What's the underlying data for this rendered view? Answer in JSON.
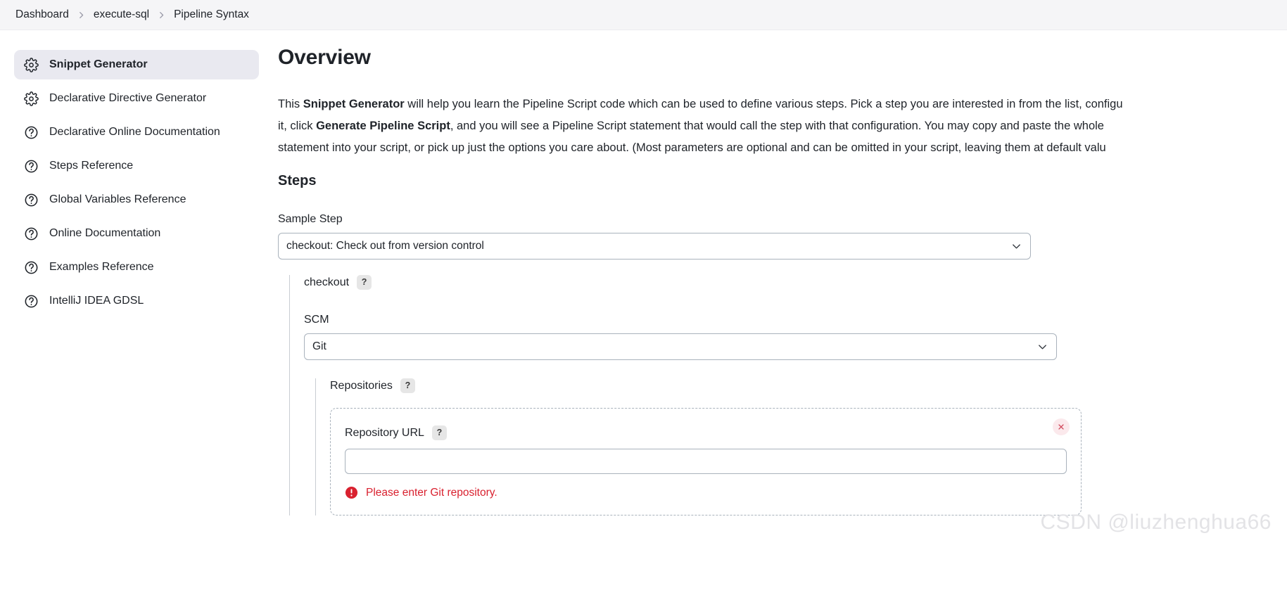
{
  "breadcrumb": {
    "items": [
      {
        "label": "Dashboard"
      },
      {
        "label": "execute-sql"
      },
      {
        "label": "Pipeline Syntax"
      }
    ],
    "separator_icon": "chevron-right-icon"
  },
  "sidebar": {
    "items": [
      {
        "label": "Snippet Generator",
        "icon": "gear-icon",
        "active": true
      },
      {
        "label": "Declarative Directive Generator",
        "icon": "gear-icon",
        "active": false
      },
      {
        "label": "Declarative Online Documentation",
        "icon": "question-circle-icon",
        "active": false
      },
      {
        "label": "Steps Reference",
        "icon": "question-circle-icon",
        "active": false
      },
      {
        "label": "Global Variables Reference",
        "icon": "question-circle-icon",
        "active": false
      },
      {
        "label": "Online Documentation",
        "icon": "question-circle-icon",
        "active": false
      },
      {
        "label": "Examples Reference",
        "icon": "question-circle-icon",
        "active": false
      },
      {
        "label": "IntelliJ IDEA GDSL",
        "icon": "question-circle-icon",
        "active": false
      }
    ]
  },
  "main": {
    "title": "Overview",
    "overview": {
      "line1_a": "This ",
      "line1_b": "Snippet Generator",
      "line1_c": " will help you learn the Pipeline Script code which can be used to define various steps. Pick a step you are interested in from the list, configu",
      "line2_a": "it, click ",
      "line2_b": "Generate Pipeline Script",
      "line2_c": ", and you will see a Pipeline Script statement that would call the step with that configuration. You may copy and paste the whole",
      "line3": "statement into your script, or pick up just the options you care about. (Most parameters are optional and can be omitted in your script, leaving them at default valu"
    },
    "steps_heading": "Steps",
    "sample_step": {
      "label": "Sample Step",
      "value": "checkout: Check out from version control",
      "chevron_icon": "chevron-down-icon"
    },
    "checkout_block": {
      "title": "checkout",
      "help_label": "?",
      "scm": {
        "label": "SCM",
        "value": "Git",
        "chevron_icon": "chevron-down-icon"
      },
      "repositories": {
        "title": "Repositories",
        "help_label": "?",
        "repo_url": {
          "label": "Repository URL",
          "help_label": "?",
          "value": "",
          "placeholder": ""
        },
        "error_text": "Please enter Git repository.",
        "error_icon": "error-exclamation-icon",
        "close_icon": "close-x-icon"
      }
    }
  },
  "watermark": {
    "text": "CSDN @liuzhenghua66"
  },
  "colors": {
    "accent_active_bg": "#e9e9f0",
    "error_red": "#d9212f",
    "border_gray": "#a9b2bc",
    "breadcrumb_bg": "#f5f5f7"
  }
}
